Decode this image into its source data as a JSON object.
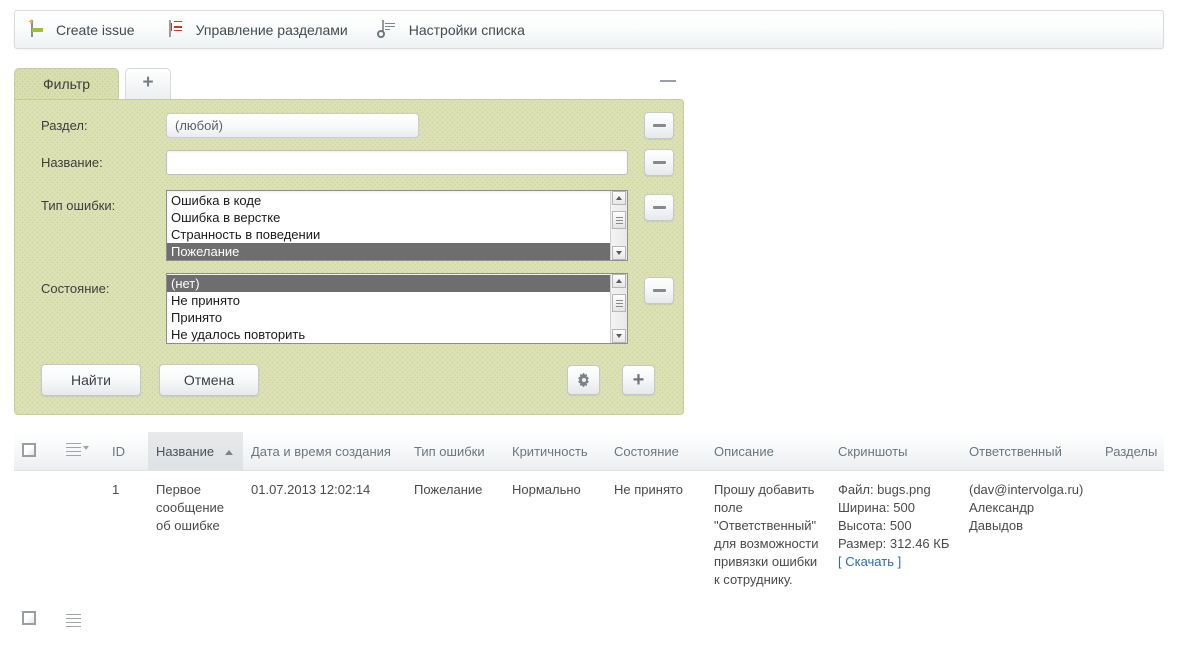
{
  "toolbar": {
    "items": [
      {
        "label": "Create issue",
        "icon": "create-issue-icon"
      },
      {
        "label": "Управление разделами",
        "icon": "manage-sections-icon"
      },
      {
        "label": "Настройки списка",
        "icon": "list-settings-icon"
      }
    ]
  },
  "filter": {
    "tabs": [
      {
        "label": "Фильтр",
        "active": true
      },
      {
        "label": "+",
        "active": false
      }
    ],
    "collapse_icon": "minimize-icon",
    "fields": [
      {
        "label": "Раздел:",
        "type": "select",
        "value": "(любой)"
      },
      {
        "label": "Название:",
        "type": "text",
        "value": "",
        "placeholder": ""
      },
      {
        "label": "Тип ошибки:",
        "type": "listbox"
      },
      {
        "label": "Состояние:",
        "type": "listbox"
      }
    ],
    "error_type_options": [
      {
        "label": "Ошибка в коде",
        "selected": false
      },
      {
        "label": "Ошибка в верстке",
        "selected": false
      },
      {
        "label": "Странность в поведении",
        "selected": false
      },
      {
        "label": "Пожелание",
        "selected": true
      }
    ],
    "state_options": [
      {
        "label": "(нет)",
        "selected": true
      },
      {
        "label": "Не принято",
        "selected": false
      },
      {
        "label": "Принято",
        "selected": false
      },
      {
        "label": "Не удалось повторить",
        "selected": false
      }
    ],
    "remove_row_label": "−",
    "buttons": {
      "search": "Найти",
      "cancel": "Отмена",
      "settings_icon": "gear-icon",
      "add_icon": "plus-icon"
    }
  },
  "table": {
    "columns": [
      {
        "key": "checkbox",
        "label": "",
        "icon": "select-all-checkbox"
      },
      {
        "key": "actions",
        "label": "",
        "icon": "actions-menu-icon"
      },
      {
        "key": "id",
        "label": "ID",
        "sorted": false
      },
      {
        "key": "name",
        "label": "Название",
        "sorted": true,
        "sort_dir": "asc"
      },
      {
        "key": "created",
        "label": "Дата и время создания",
        "sorted": false
      },
      {
        "key": "error_type",
        "label": "Тип ошибки",
        "sorted": false
      },
      {
        "key": "severity",
        "label": "Критичность",
        "sorted": false
      },
      {
        "key": "state",
        "label": "Состояние",
        "sorted": false
      },
      {
        "key": "description",
        "label": "Описание",
        "sorted": false
      },
      {
        "key": "screenshots",
        "label": "Скриншоты",
        "sorted": false
      },
      {
        "key": "assignee",
        "label": "Ответственный",
        "sorted": false
      },
      {
        "key": "sections",
        "label": "Разделы",
        "sorted": false
      }
    ],
    "rows": [
      {
        "id": "1",
        "name": "Первое сообщение об ошибке",
        "created": "01.07.2013 12:02:14",
        "error_type": "Пожелание",
        "severity": "Нормально",
        "state": "Не принято",
        "description": "Прошу добавить поле \"Ответственный\" для возможности привязки ошибки к сотруднику.",
        "screenshot": {
          "file": "Файл: bugs.png",
          "width": "Ширина: 500",
          "height": "Высота: 500",
          "size": "Размер: 312.46 КБ",
          "download": "[ Скачать ]"
        },
        "assignee_email": "(dav@intervolga.ru)",
        "assignee_name": "Александр Давыдов",
        "sections": ""
      }
    ]
  },
  "colors": {
    "filter_panel": "#dde2b6",
    "tab_active": "#d9dfb0",
    "link": "#2b6ca3",
    "selection": "#6e6e6e",
    "accent_green": "#9fbf3b",
    "accent_red": "#c0392b"
  }
}
